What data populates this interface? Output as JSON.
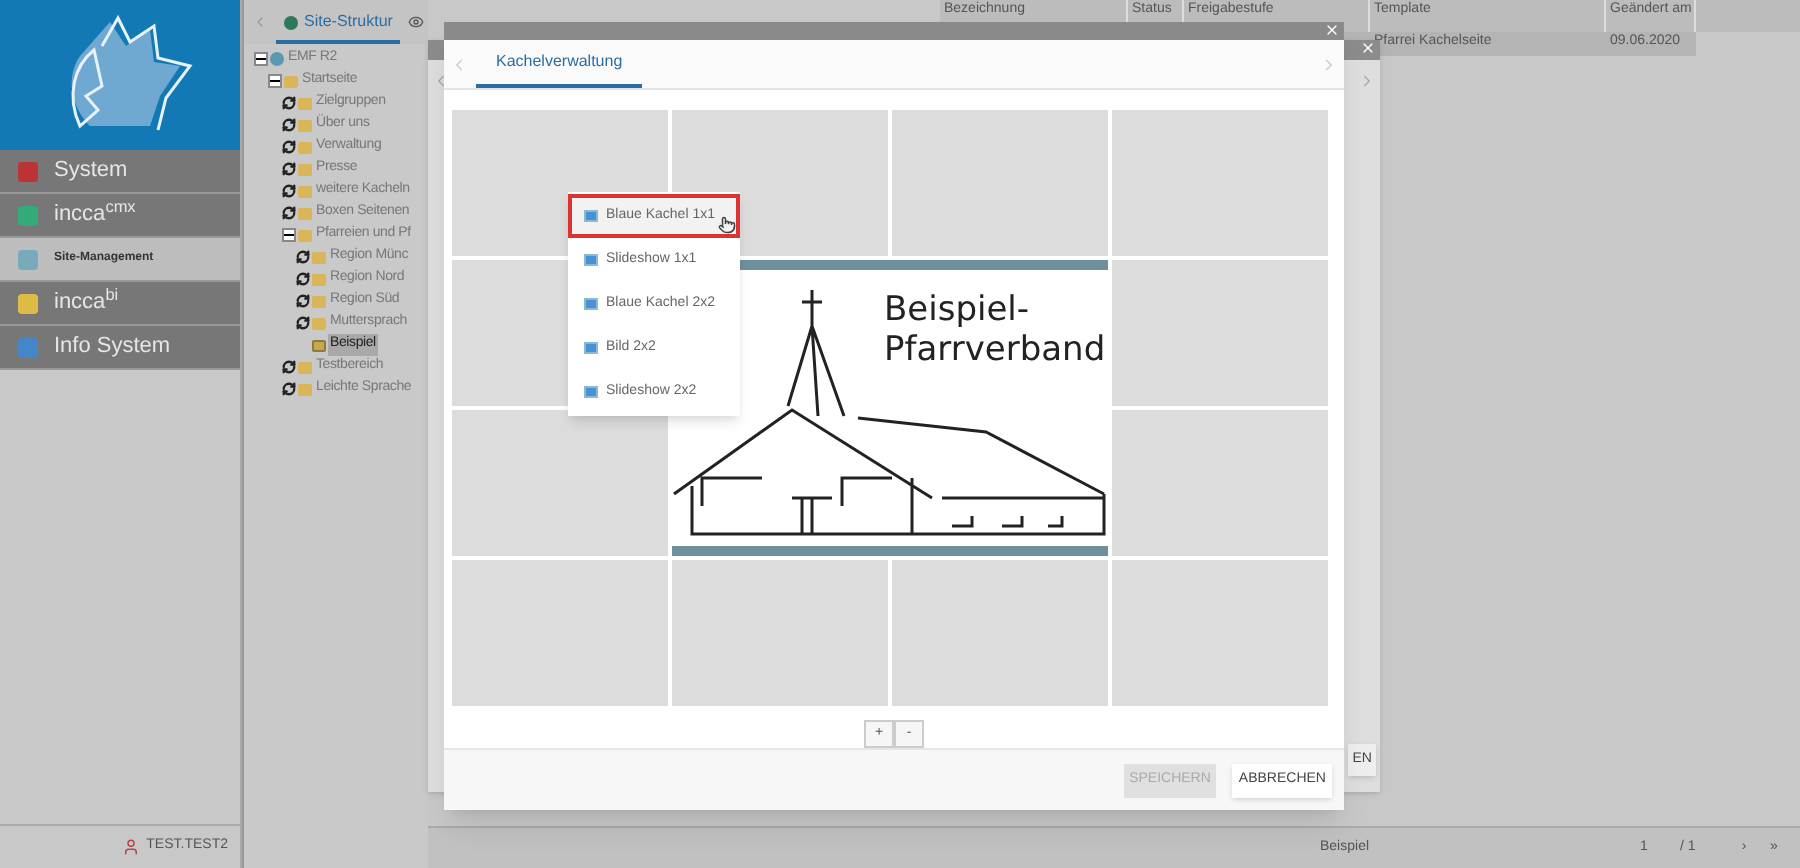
{
  "sidebar": {
    "menu": [
      {
        "label": "System",
        "selected": false
      },
      {
        "label": "incca$^{cmx}$",
        "selected": false
      },
      {
        "label": "Site-Management",
        "selected": true
      },
      {
        "label": "incca$^{bi}$",
        "selected": false
      },
      {
        "label": "Info System",
        "selected": false
      }
    ],
    "user": "TEST.TEST2"
  },
  "tree": {
    "tabs": [
      {
        "label": "Site-Struktur",
        "selected": true
      }
    ],
    "items": [
      {
        "label": "EMF R2",
        "kind": "root",
        "expanded": true,
        "selected": false,
        "children": [
          {
            "label": "Startseite",
            "kind": "branch",
            "expanded": true,
            "selected": false,
            "children": [
              {
                "label": "Zielgruppen",
                "kind": "branch",
                "expanded": false,
                "selected": false
              },
              {
                "label": "Über uns",
                "kind": "branch",
                "expanded": false,
                "selected": false
              },
              {
                "label": "Verwaltung",
                "kind": "branch",
                "expanded": false,
                "selected": false
              },
              {
                "label": "Presse",
                "kind": "branch",
                "expanded": false,
                "selected": false
              },
              {
                "label": "weitere Kacheln",
                "kind": "branch",
                "expanded": false,
                "selected": false
              },
              {
                "label": "Boxen Seitenen",
                "kind": "branch",
                "expanded": false,
                "selected": false
              },
              {
                "label": "Pfarreien und Pf",
                "kind": "branch",
                "expanded": true,
                "selected": false,
                "children": [
                  {
                    "label": "Region Münc",
                    "kind": "branch",
                    "expanded": false,
                    "selected": false
                  },
                  {
                    "label": "Region Nord",
                    "kind": "branch",
                    "expanded": false,
                    "selected": false
                  },
                  {
                    "label": "Region Süd",
                    "kind": "branch",
                    "expanded": false,
                    "selected": false
                  },
                  {
                    "label": "Muttersprach",
                    "kind": "branch",
                    "expanded": false,
                    "selected": false
                  },
                  {
                    "label": "Beispiel",
                    "kind": "leaf",
                    "expanded": false,
                    "selected": true
                  }
                ]
              },
              {
                "label": "Testbereich",
                "kind": "branch",
                "expanded": false,
                "selected": false
              },
              {
                "label": "Leichte Sprache",
                "kind": "branch",
                "expanded": false,
                "selected": false
              }
            ]
          }
        ]
      }
    ]
  },
  "table": {
    "columns": [
      "Bezeichnung",
      "Status",
      "Freigabestufe",
      "Template",
      "Geändert am"
    ],
    "rows": [
      {
        "selected": true,
        "cells": [
          "",
          "",
          "",
          "Pfarrei Kachelseite",
          "09.06.2020"
        ]
      }
    ]
  },
  "status_bar": {
    "name": "Beispiel",
    "page": "1",
    "pages": "/ 1",
    "next": "›",
    "last": "»"
  },
  "back_dialog": {
    "button": "EN"
  },
  "dialog": {
    "tabs": [
      {
        "label": "Kachelverwaltung",
        "selected": true
      }
    ],
    "tiles": [
      {
        "kind": "empty"
      },
      {
        "kind": "empty"
      },
      {
        "kind": "empty"
      },
      {
        "kind": "empty"
      },
      {
        "kind": "empty"
      },
      {
        "kind": "image",
        "lines": [
          "Beispiel-",
          "Pfarrverband"
        ]
      },
      {
        "kind": "empty"
      },
      {
        "kind": "empty"
      },
      {
        "kind": "empty"
      },
      {
        "kind": "empty"
      },
      {
        "kind": "empty"
      },
      {
        "kind": "empty"
      },
      {
        "kind": "empty"
      }
    ],
    "menu": [
      {
        "label": "Blaue Kachel 1x1",
        "selected": true
      },
      {
        "label": "Slideshow 1x1",
        "selected": false
      },
      {
        "label": "Blaue Kachel 2x2",
        "selected": false
      },
      {
        "label": "Bild 2x2",
        "selected": false
      },
      {
        "label": "Slideshow 2x2",
        "selected": false
      }
    ],
    "zoom": [
      "+",
      "-"
    ],
    "buttons": [
      {
        "label": "SPEICHERN",
        "disabled": true
      },
      {
        "label": "ABBRECHEN",
        "disabled": false
      }
    ]
  }
}
